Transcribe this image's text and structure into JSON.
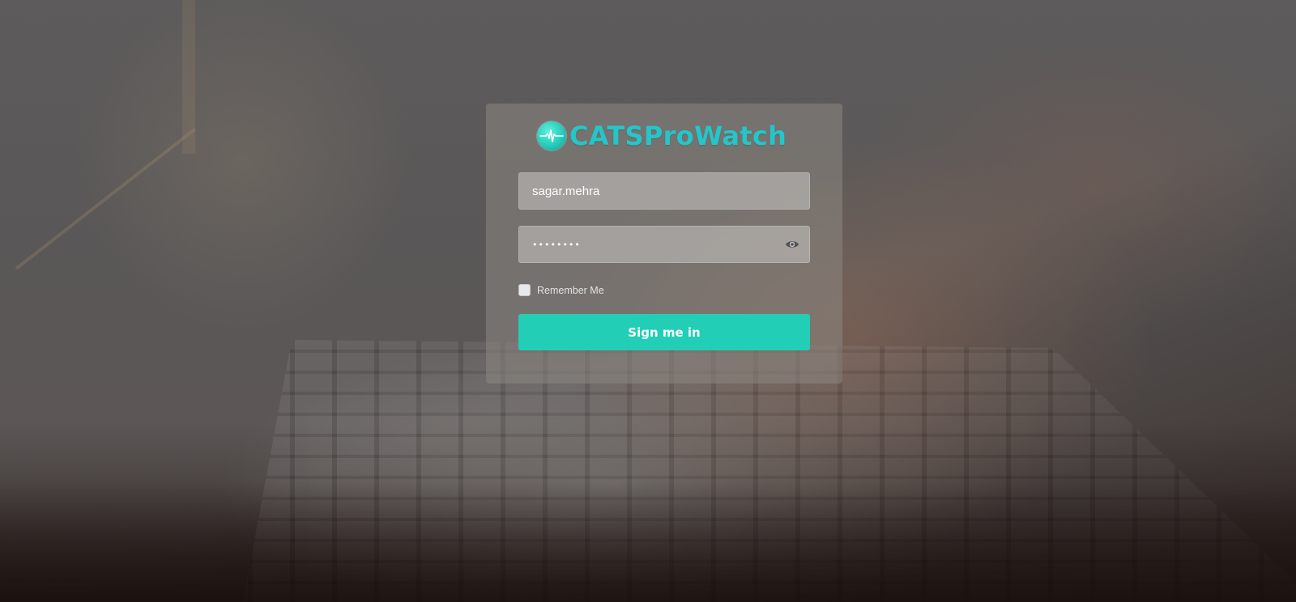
{
  "app": {
    "brand_name": "CATSProWatch",
    "brand_color": "#24c6c9",
    "logo_icon": "heartbeat-pulse-icon"
  },
  "login": {
    "username_value": "sagar.mehra",
    "password_mask": "••••••••",
    "show_password_icon": "eye-icon",
    "remember_label": "Remember Me",
    "remember_checked": false,
    "submit_label": "Sign me in",
    "submit_color": "#22ceb5"
  }
}
